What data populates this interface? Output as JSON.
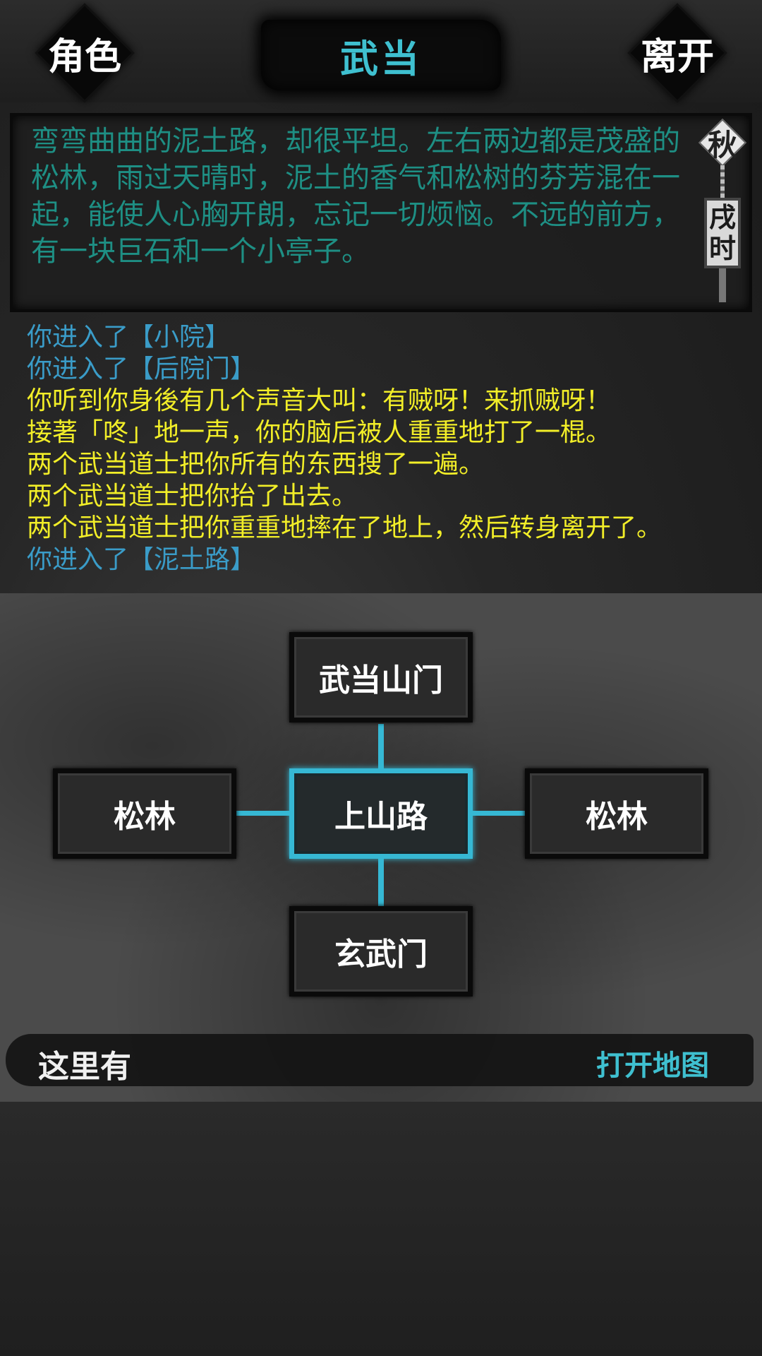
{
  "header": {
    "left_button": "角色",
    "title": "武当",
    "right_button": "离开"
  },
  "description": "弯弯曲曲的泥土路，却很平坦。左右两边都是茂盛的松林，雨过天晴时，泥土的香气和松树的芬芳混在一起，能使人心胸开朗，忘记一切烦恼。不远的前方，有一块巨石和一个小亭子。",
  "clock": {
    "season": "秋",
    "time_chars": [
      "戌",
      "时"
    ]
  },
  "log": [
    {
      "text": "你进入了【小院】",
      "color": "cyan"
    },
    {
      "text": "你进入了【后院门】",
      "color": "cyan"
    },
    {
      "text": "你听到你身後有几个声音大叫：有贼呀！来抓贼呀！",
      "color": "yellow"
    },
    {
      "text": "接著「咚」地一声，你的脑后被人重重地打了一棍。",
      "color": "yellow"
    },
    {
      "text": "两个武当道士把你所有的东西搜了一遍。",
      "color": "yellow"
    },
    {
      "text": "两个武当道士把你抬了出去。",
      "color": "yellow"
    },
    {
      "text": "两个武当道士把你重重地摔在了地上，然后转身离开了。",
      "color": "yellow"
    },
    {
      "text": "你进入了【泥土路】",
      "color": "cyan"
    }
  ],
  "map": {
    "north": "武当山门",
    "west": "松林",
    "center": "上山路",
    "east": "松林",
    "south": "玄武门"
  },
  "footer": {
    "here_label": "这里有",
    "open_map": "打开地图"
  },
  "colors": {
    "accent": "#36b8d4",
    "title": "#3fc0d0",
    "description": "#1e8f84",
    "log_cyan": "#3a9cc8",
    "log_yellow": "#f2ee28"
  }
}
